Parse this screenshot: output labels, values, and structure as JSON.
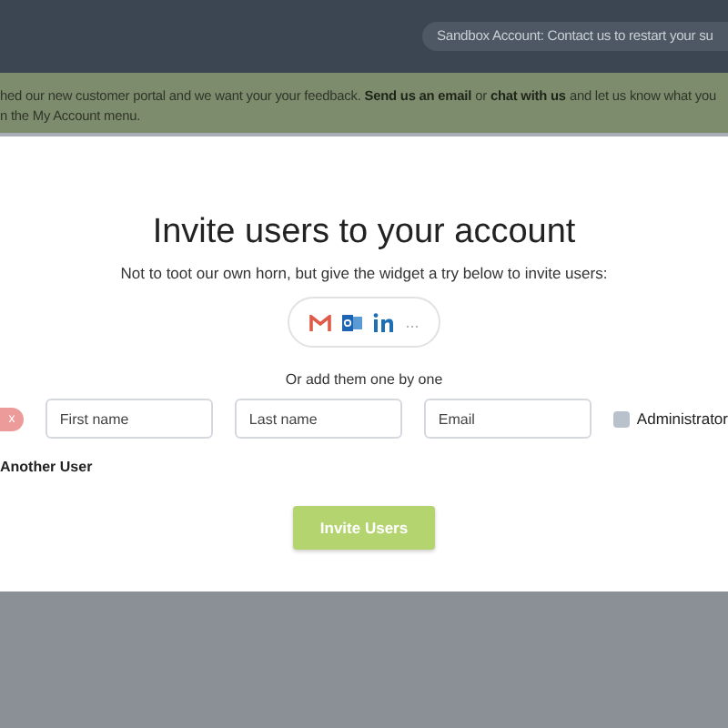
{
  "top_bar": {
    "notice": "Sandbox Account: Contact us to restart your su"
  },
  "banner": {
    "lines": [
      [
        {
          "kind": "text",
          "text": "hed our new customer portal and we want your your feedback."
        },
        {
          "kind": "link",
          "text": "Send us an email"
        },
        {
          "kind": "text",
          "text": "or"
        },
        {
          "kind": "link",
          "text": "chat with us"
        },
        {
          "kind": "text",
          "text": "and let us know what you"
        }
      ],
      [
        {
          "kind": "text",
          "text": "n the My Account menu."
        }
      ]
    ]
  },
  "modal": {
    "title": "Invite users to your account",
    "subtitle": "Not to toot our own horn, but give the widget a try below to invite users:",
    "import_widget": {
      "more": "..."
    },
    "divider_text": "Or add them one by one",
    "user_row": {
      "remove": "x",
      "fields": [
        {
          "placeholder": "First name"
        },
        {
          "placeholder": "Last name"
        },
        {
          "placeholder": "Email"
        }
      ],
      "administrator": {
        "label": "Administrator",
        "checked": false
      }
    },
    "add_link": "Another User",
    "submit": "Invite Users"
  }
}
